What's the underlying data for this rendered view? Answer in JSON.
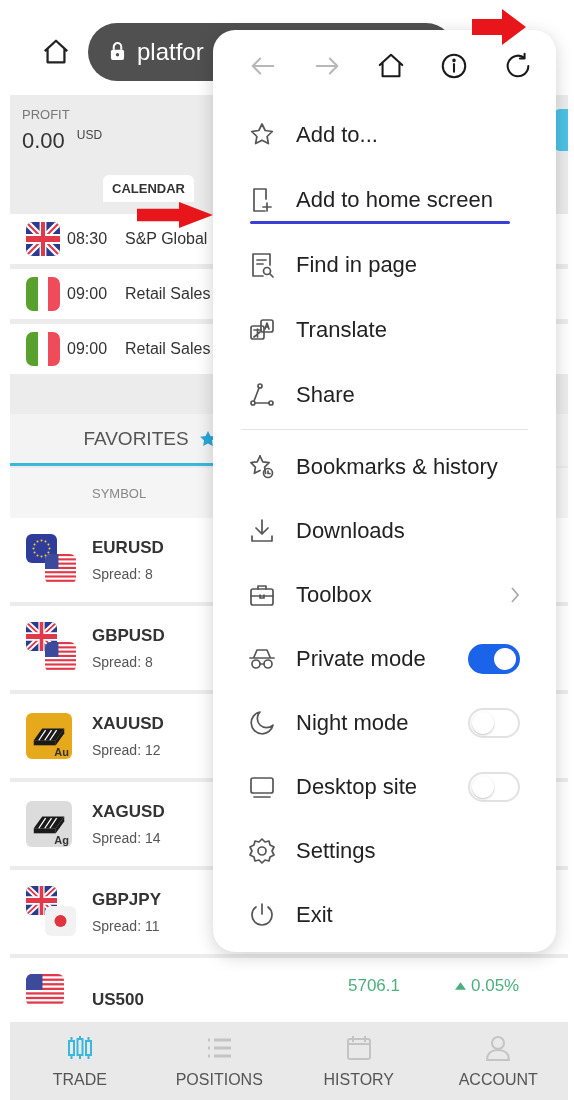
{
  "browser": {
    "url": "platfor"
  },
  "profit": {
    "label": "PROFIT",
    "value": "0.00",
    "currency": "USD"
  },
  "calendar_tab": {
    "label": "CALENDAR"
  },
  "events": [
    {
      "time": "08:30",
      "title": "S&P Global"
    },
    {
      "time": "09:00",
      "title": "Retail Sales"
    },
    {
      "time": "09:00",
      "title": "Retail Sales"
    }
  ],
  "favorites_tab": {
    "label": "FAVORITES"
  },
  "table": {
    "columns": [
      "SYMBOL"
    ],
    "rows": [
      {
        "symbol": "EURUSD",
        "spread": "Spread: 8"
      },
      {
        "symbol": "GBPUSD",
        "spread": "Spread: 8"
      },
      {
        "symbol": "XAUUSD",
        "spread": "Spread: 12",
        "badge": "Au"
      },
      {
        "symbol": "XAGUSD",
        "spread": "Spread: 14",
        "badge": "Ag"
      },
      {
        "symbol": "GBPJPY",
        "spread": "Spread: 11"
      },
      {
        "symbol": "US500",
        "price": "5706.1",
        "change": "0.05%"
      }
    ]
  },
  "bottom_nav": [
    {
      "label": "TRADE",
      "selected": true
    },
    {
      "label": "POSITIONS",
      "selected": false
    },
    {
      "label": "HISTORY",
      "selected": false
    },
    {
      "label": "ACCOUNT",
      "selected": false
    }
  ],
  "menu": {
    "toolbar": [
      {
        "kind": "back",
        "disabled": true
      },
      {
        "kind": "forward",
        "disabled": true
      },
      {
        "kind": "home",
        "disabled": false
      },
      {
        "kind": "info",
        "disabled": false
      },
      {
        "kind": "reload",
        "disabled": false
      }
    ],
    "sections": [
      {
        "items": [
          {
            "label": "Add to...",
            "kind": "action",
            "highlighted": false
          },
          {
            "label": "Add to home screen",
            "kind": "action",
            "highlighted": true
          },
          {
            "label": "Find in page",
            "kind": "action",
            "highlighted": false
          },
          {
            "label": "Translate",
            "kind": "action",
            "highlighted": false
          },
          {
            "label": "Share",
            "kind": "action",
            "highlighted": false
          }
        ]
      },
      {
        "items": [
          {
            "label": "Bookmarks & history",
            "kind": "action",
            "highlighted": false
          },
          {
            "label": "Downloads",
            "kind": "action",
            "highlighted": false
          },
          {
            "label": "Toolbox",
            "kind": "submenu",
            "highlighted": false
          },
          {
            "label": "Private mode",
            "kind": "toggle",
            "on": true,
            "highlighted": false
          },
          {
            "label": "Night mode",
            "kind": "toggle",
            "on": false,
            "highlighted": false
          },
          {
            "label": "Desktop site",
            "kind": "toggle",
            "on": false,
            "highlighted": false
          },
          {
            "label": "Settings",
            "kind": "action",
            "highlighted": false
          },
          {
            "label": "Exit",
            "kind": "action",
            "highlighted": false
          }
        ]
      }
    ]
  }
}
